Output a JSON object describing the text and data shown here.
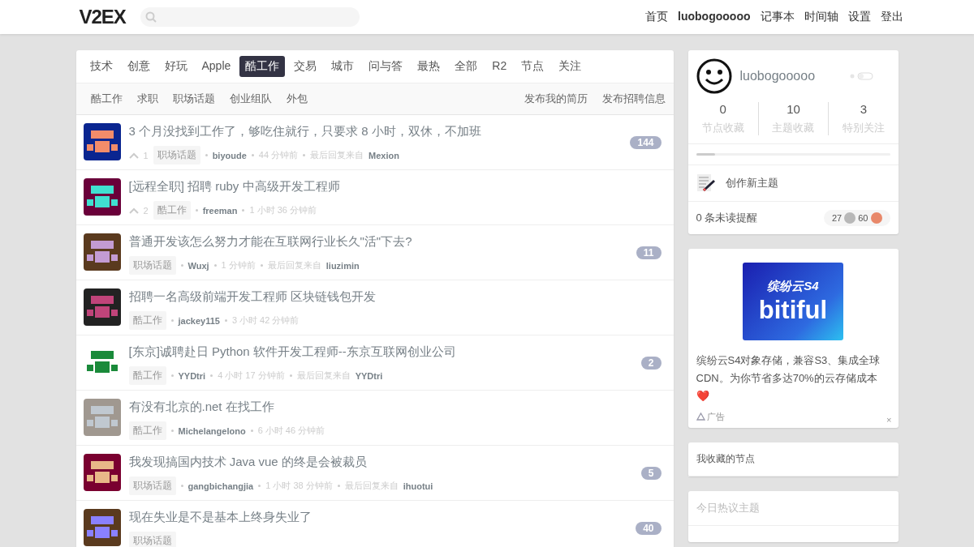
{
  "header": {
    "logo": "V2EX",
    "nav": [
      {
        "label": "首页",
        "bold": false
      },
      {
        "label": "luobogooooo",
        "bold": true
      },
      {
        "label": "记事本",
        "bold": false
      },
      {
        "label": "时间轴",
        "bold": false
      },
      {
        "label": "设置",
        "bold": false
      },
      {
        "label": "登出",
        "bold": false
      }
    ]
  },
  "tabs": [
    {
      "label": "技术",
      "selected": false
    },
    {
      "label": "创意",
      "selected": false
    },
    {
      "label": "好玩",
      "selected": false
    },
    {
      "label": "Apple",
      "selected": false
    },
    {
      "label": "酷工作",
      "selected": true
    },
    {
      "label": "交易",
      "selected": false
    },
    {
      "label": "城市",
      "selected": false
    },
    {
      "label": "问与答",
      "selected": false
    },
    {
      "label": "最热",
      "selected": false
    },
    {
      "label": "全部",
      "selected": false
    },
    {
      "label": "R2",
      "selected": false
    },
    {
      "label": "节点",
      "selected": false
    },
    {
      "label": "关注",
      "selected": false
    }
  ],
  "subtabs": [
    "酷工作",
    "求职",
    "职场话题",
    "创业组队",
    "外包"
  ],
  "subactions": [
    "发布我的简历",
    "发布招聘信息"
  ],
  "topics": [
    {
      "title": "3 个月没找到工作了，够吃住就行，只要求 8 小时，双休，不加班",
      "votes": "1",
      "node": "职场话题",
      "author": "biyoude",
      "time": "44 分钟前",
      "last_reply_label": "最后回复来自",
      "last_reply_by": "Mexion",
      "replies": "144"
    },
    {
      "title": "[远程全职] 招聘 ruby 中高级开发工程师",
      "votes": "2",
      "node": "酷工作",
      "author": "freeman",
      "time": "1 小时 36 分钟前"
    },
    {
      "title": "普通开发该怎么努力才能在互联网行业长久\"活\"下去?",
      "node": "职场话题",
      "author": "Wuxj",
      "time": "1 分钟前",
      "last_reply_label": "最后回复来自",
      "last_reply_by": "liuzimin",
      "replies": "11"
    },
    {
      "title": "招聘一名高级前端开发工程师 区块链钱包开发",
      "node": "酷工作",
      "author": "jackey115",
      "time": "3 小时 42 分钟前"
    },
    {
      "title": "[东京]诚聘赴日 Python 软件开发工程师--东京互联网创业公司",
      "node": "酷工作",
      "author": "YYDtri",
      "time": "4 小时 17 分钟前",
      "last_reply_label": "最后回复来自",
      "last_reply_by": "YYDtri",
      "replies": "2"
    },
    {
      "title": "有没有北京的.net 在找工作",
      "node": "酷工作",
      "author": "Michelangelono",
      "time": "6 小时 46 分钟前"
    },
    {
      "title": "我发现搞国内技术 Java vue 的终是会被裁员",
      "node": "职场话题",
      "author": "gangbichangjia",
      "time": "1 小时 38 分钟前",
      "last_reply_label": "最后回复来自",
      "last_reply_by": "ihuotui",
      "replies": "5"
    },
    {
      "title": "现在失业是不是基本上终身失业了",
      "node": "职场话题",
      "replies": "40"
    }
  ],
  "profile": {
    "username": "luobogooooo",
    "stats": [
      {
        "value": "0",
        "label": "节点收藏"
      },
      {
        "value": "10",
        "label": "主题收藏"
      },
      {
        "value": "3",
        "label": "特别关注"
      }
    ],
    "level": 0.1,
    "create": "创作新主题",
    "unread": "0 条未读提醒",
    "coins": [
      {
        "count": "27",
        "color": "#b8b8b8"
      },
      {
        "count": "60",
        "color": "#e8886a"
      }
    ]
  },
  "ad": {
    "banner_title": "缤纷云S4",
    "banner_brand": "bitiful",
    "text": "缤纷云S4对象存储，兼容S3、集成全球CDN。为你节省多达70%的云存储成本",
    "emoji": "❤️",
    "label": "广告",
    "close": "×"
  },
  "cards": [
    {
      "title": "我收藏的节点",
      "muted": false
    },
    {
      "title": "今日热议主题",
      "muted": true
    }
  ]
}
